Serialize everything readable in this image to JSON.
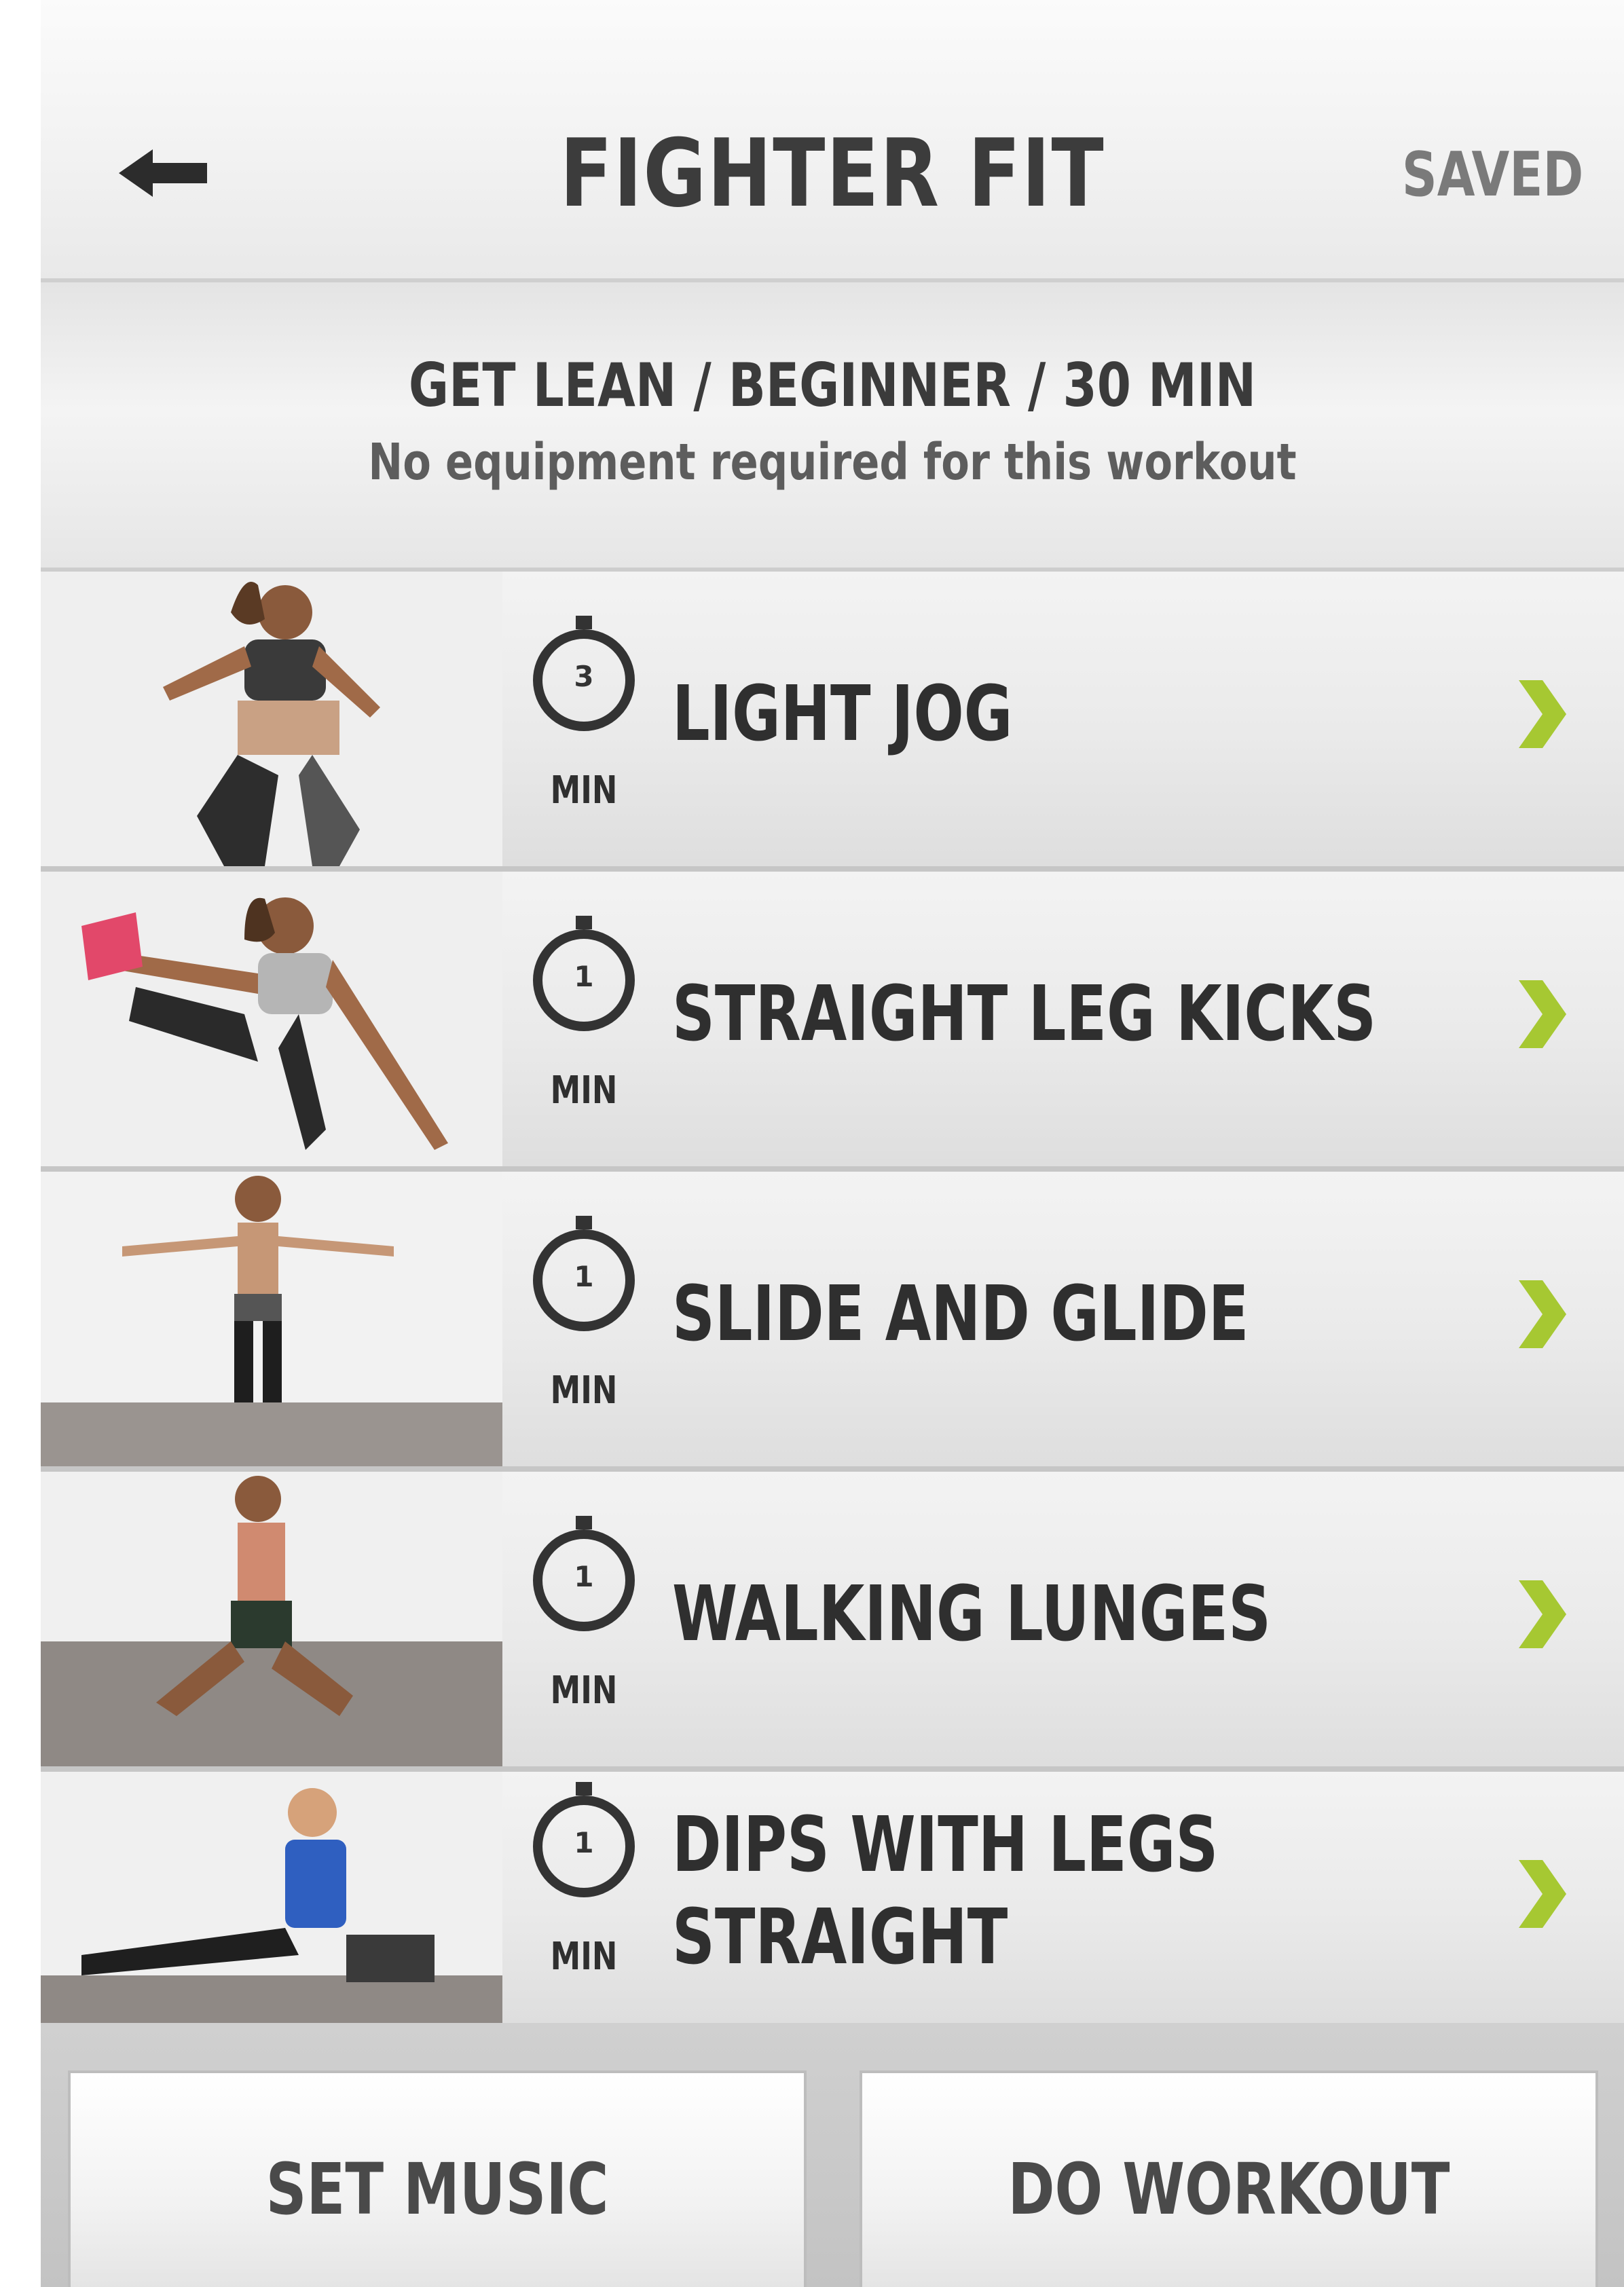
{
  "header": {
    "title": "FIGHTER FIT",
    "saved_label": "SAVED"
  },
  "workout": {
    "summary": "GET LEAN / BEGINNER / 30 MIN",
    "note": "No equipment required for this workout"
  },
  "exercises": [
    {
      "name": "LIGHT JOG",
      "minutes": "3",
      "unit": "MIN"
    },
    {
      "name": "STRAIGHT LEG KICKS",
      "minutes": "1",
      "unit": "MIN"
    },
    {
      "name": "SLIDE AND GLIDE",
      "minutes": "1",
      "unit": "MIN"
    },
    {
      "name": "WALKING LUNGES",
      "minutes": "1",
      "unit": "MIN"
    },
    {
      "name": "DIPS WITH LEGS STRAIGHT",
      "minutes": "1",
      "unit": "MIN"
    }
  ],
  "footer": {
    "set_music_label": "SET MUSIC",
    "do_workout_label": "DO WORKOUT"
  },
  "colors": {
    "accent": "#a6c832",
    "text": "#2f2f2f"
  }
}
